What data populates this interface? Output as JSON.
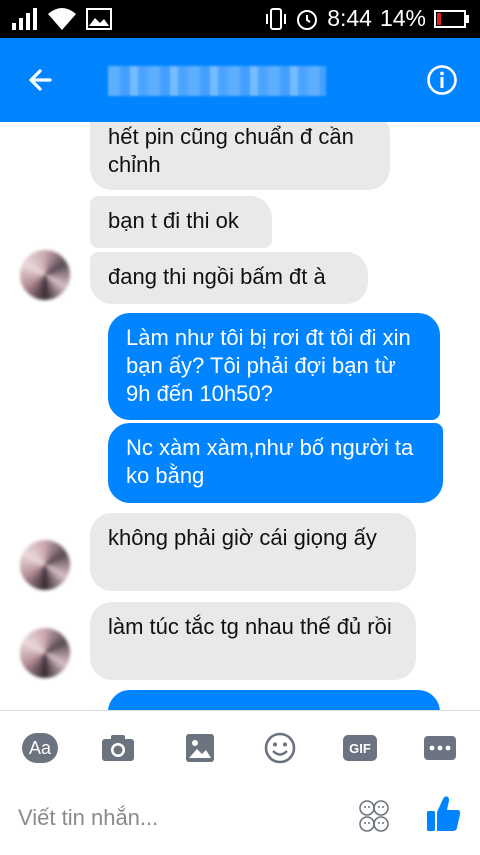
{
  "status": {
    "time": "8:44",
    "battery": "14%"
  },
  "messages": [
    {
      "dir": "in",
      "text": "hết pin cũng chuẩn đ cần chỉnh"
    },
    {
      "dir": "in",
      "text": "bạn t đi thi ok"
    },
    {
      "dir": "in",
      "text": "đang thi ngồi bấm đt à"
    },
    {
      "dir": "out",
      "text": "Làm như tôi bị rơi đt tôi đi xin bạn ấy? Tôi phải đợi bạn từ 9h đến 10h50?"
    },
    {
      "dir": "out",
      "text": "Nc xàm xàm,như bố người ta ko bằng"
    },
    {
      "dir": "in",
      "text": "không phải giờ cái giọng ấy"
    },
    {
      "dir": "in",
      "text": "làm túc tắc tg nhau thế đủ rồi"
    },
    {
      "dir": "out",
      "text": ""
    }
  ],
  "composer": {
    "aa_label": "Aa",
    "gif_label": "GIF",
    "placeholder": "Viết tin nhắn..."
  },
  "colors": {
    "accent": "#0084ff",
    "incoming": "#e9e9eb"
  },
  "icons": [
    "back-arrow-icon",
    "info-icon",
    "camera-icon",
    "image-icon",
    "emoji-icon",
    "more-icon",
    "stickers-icon",
    "thumbs-up-icon"
  ]
}
